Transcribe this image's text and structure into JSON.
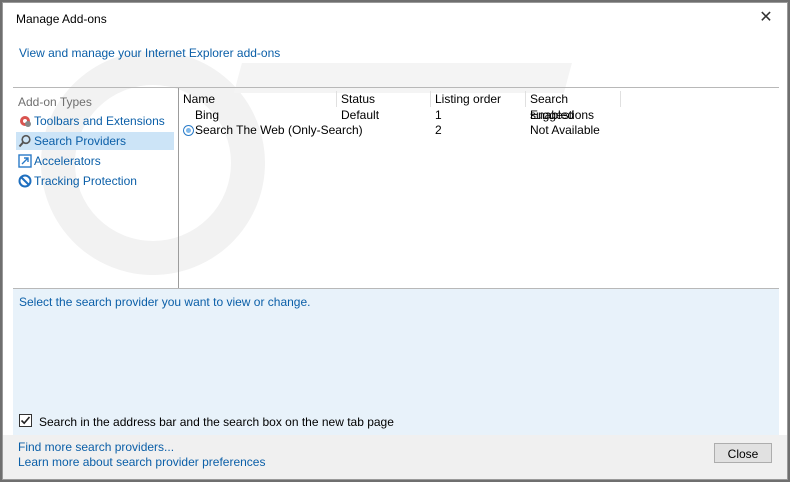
{
  "window": {
    "title": "Manage Add-ons"
  },
  "header": {
    "link": "View and manage your Internet Explorer add-ons"
  },
  "sidebar": {
    "heading": "Add-on Types",
    "items": [
      {
        "label": "Toolbars and Extensions",
        "icon": "gear-icon"
      },
      {
        "label": "Search Providers",
        "icon": "search-icon"
      },
      {
        "label": "Accelerators",
        "icon": "accelerator-icon"
      },
      {
        "label": "Tracking Protection",
        "icon": "block-icon"
      }
    ]
  },
  "list": {
    "columns": [
      "Name",
      "Status",
      "Listing order",
      "Search suggestions"
    ],
    "rows": [
      {
        "name": "Bing",
        "status": "Default",
        "order": "1",
        "suggestions": "Enabled"
      },
      {
        "name": "Search The Web (Only-Search)",
        "status": "",
        "order": "2",
        "suggestions": "Not Available"
      }
    ]
  },
  "details": {
    "text": "Select the search provider you want to view or change.",
    "checkbox_label": "Search in the address bar and the search box on the new tab page",
    "checkbox_checked": true
  },
  "footer": {
    "link1": "Find more search providers...",
    "link2": "Learn more about search provider preferences",
    "close_label": "Close"
  },
  "colors": {
    "link": "#0b5fa8",
    "selection": "#cce4f7",
    "details_bg": "#e8f2fa"
  }
}
